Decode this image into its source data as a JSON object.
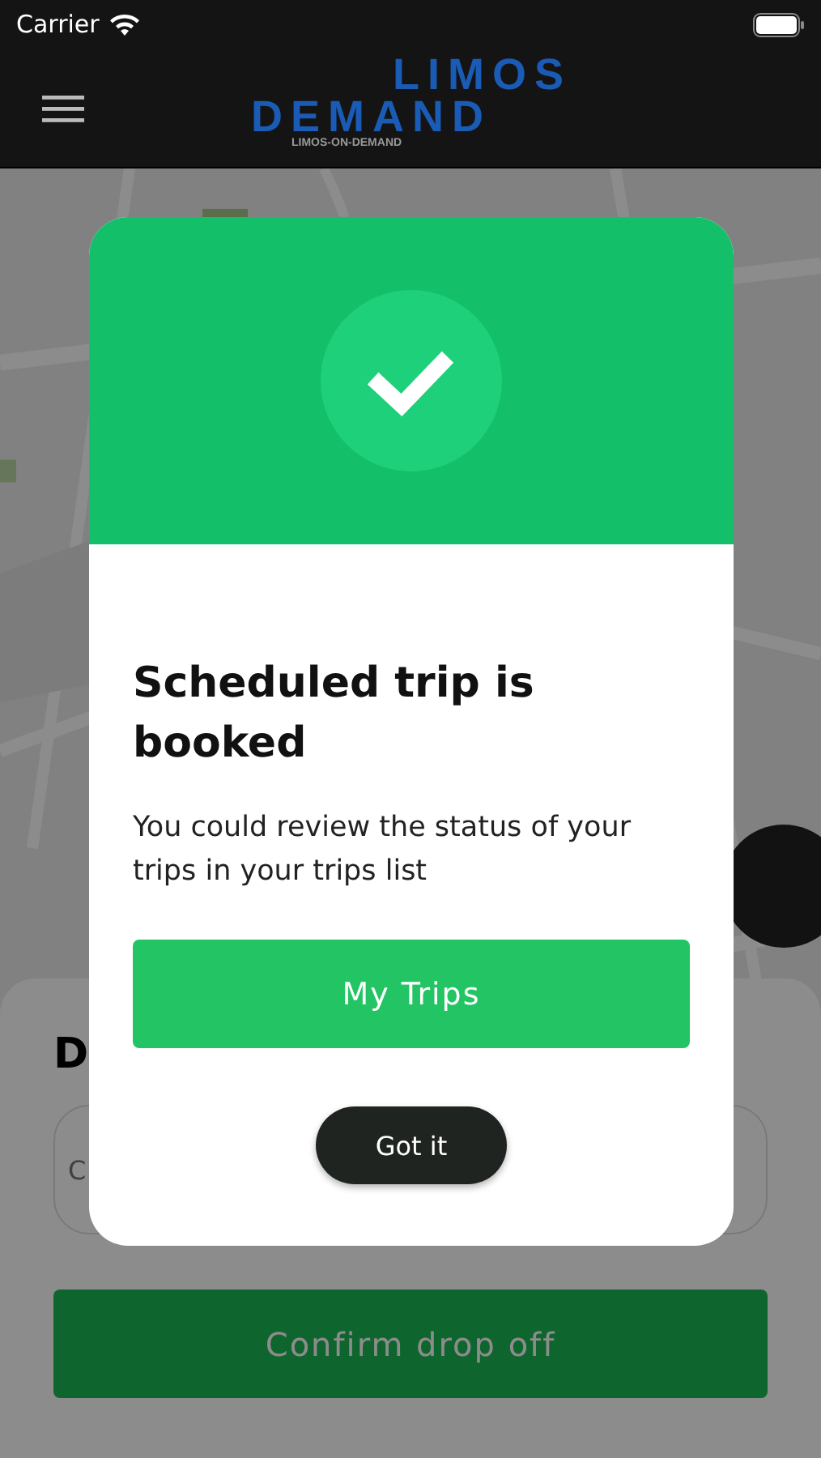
{
  "status_bar": {
    "carrier": "Carrier"
  },
  "header": {
    "logo": {
      "line_1": "LIMOS",
      "line_2": "DEMAND",
      "tagline": "LIMOS-ON-DEMAND"
    }
  },
  "bottom_sheet": {
    "heading": "D",
    "field_placeholder": "C",
    "confirm_button": "Confirm drop off"
  },
  "dialog": {
    "title": "Scheduled trip is booked",
    "message": "You could review the status of your trips in your trips list",
    "primary_button": "My Trips",
    "secondary_button": "Got it"
  }
}
